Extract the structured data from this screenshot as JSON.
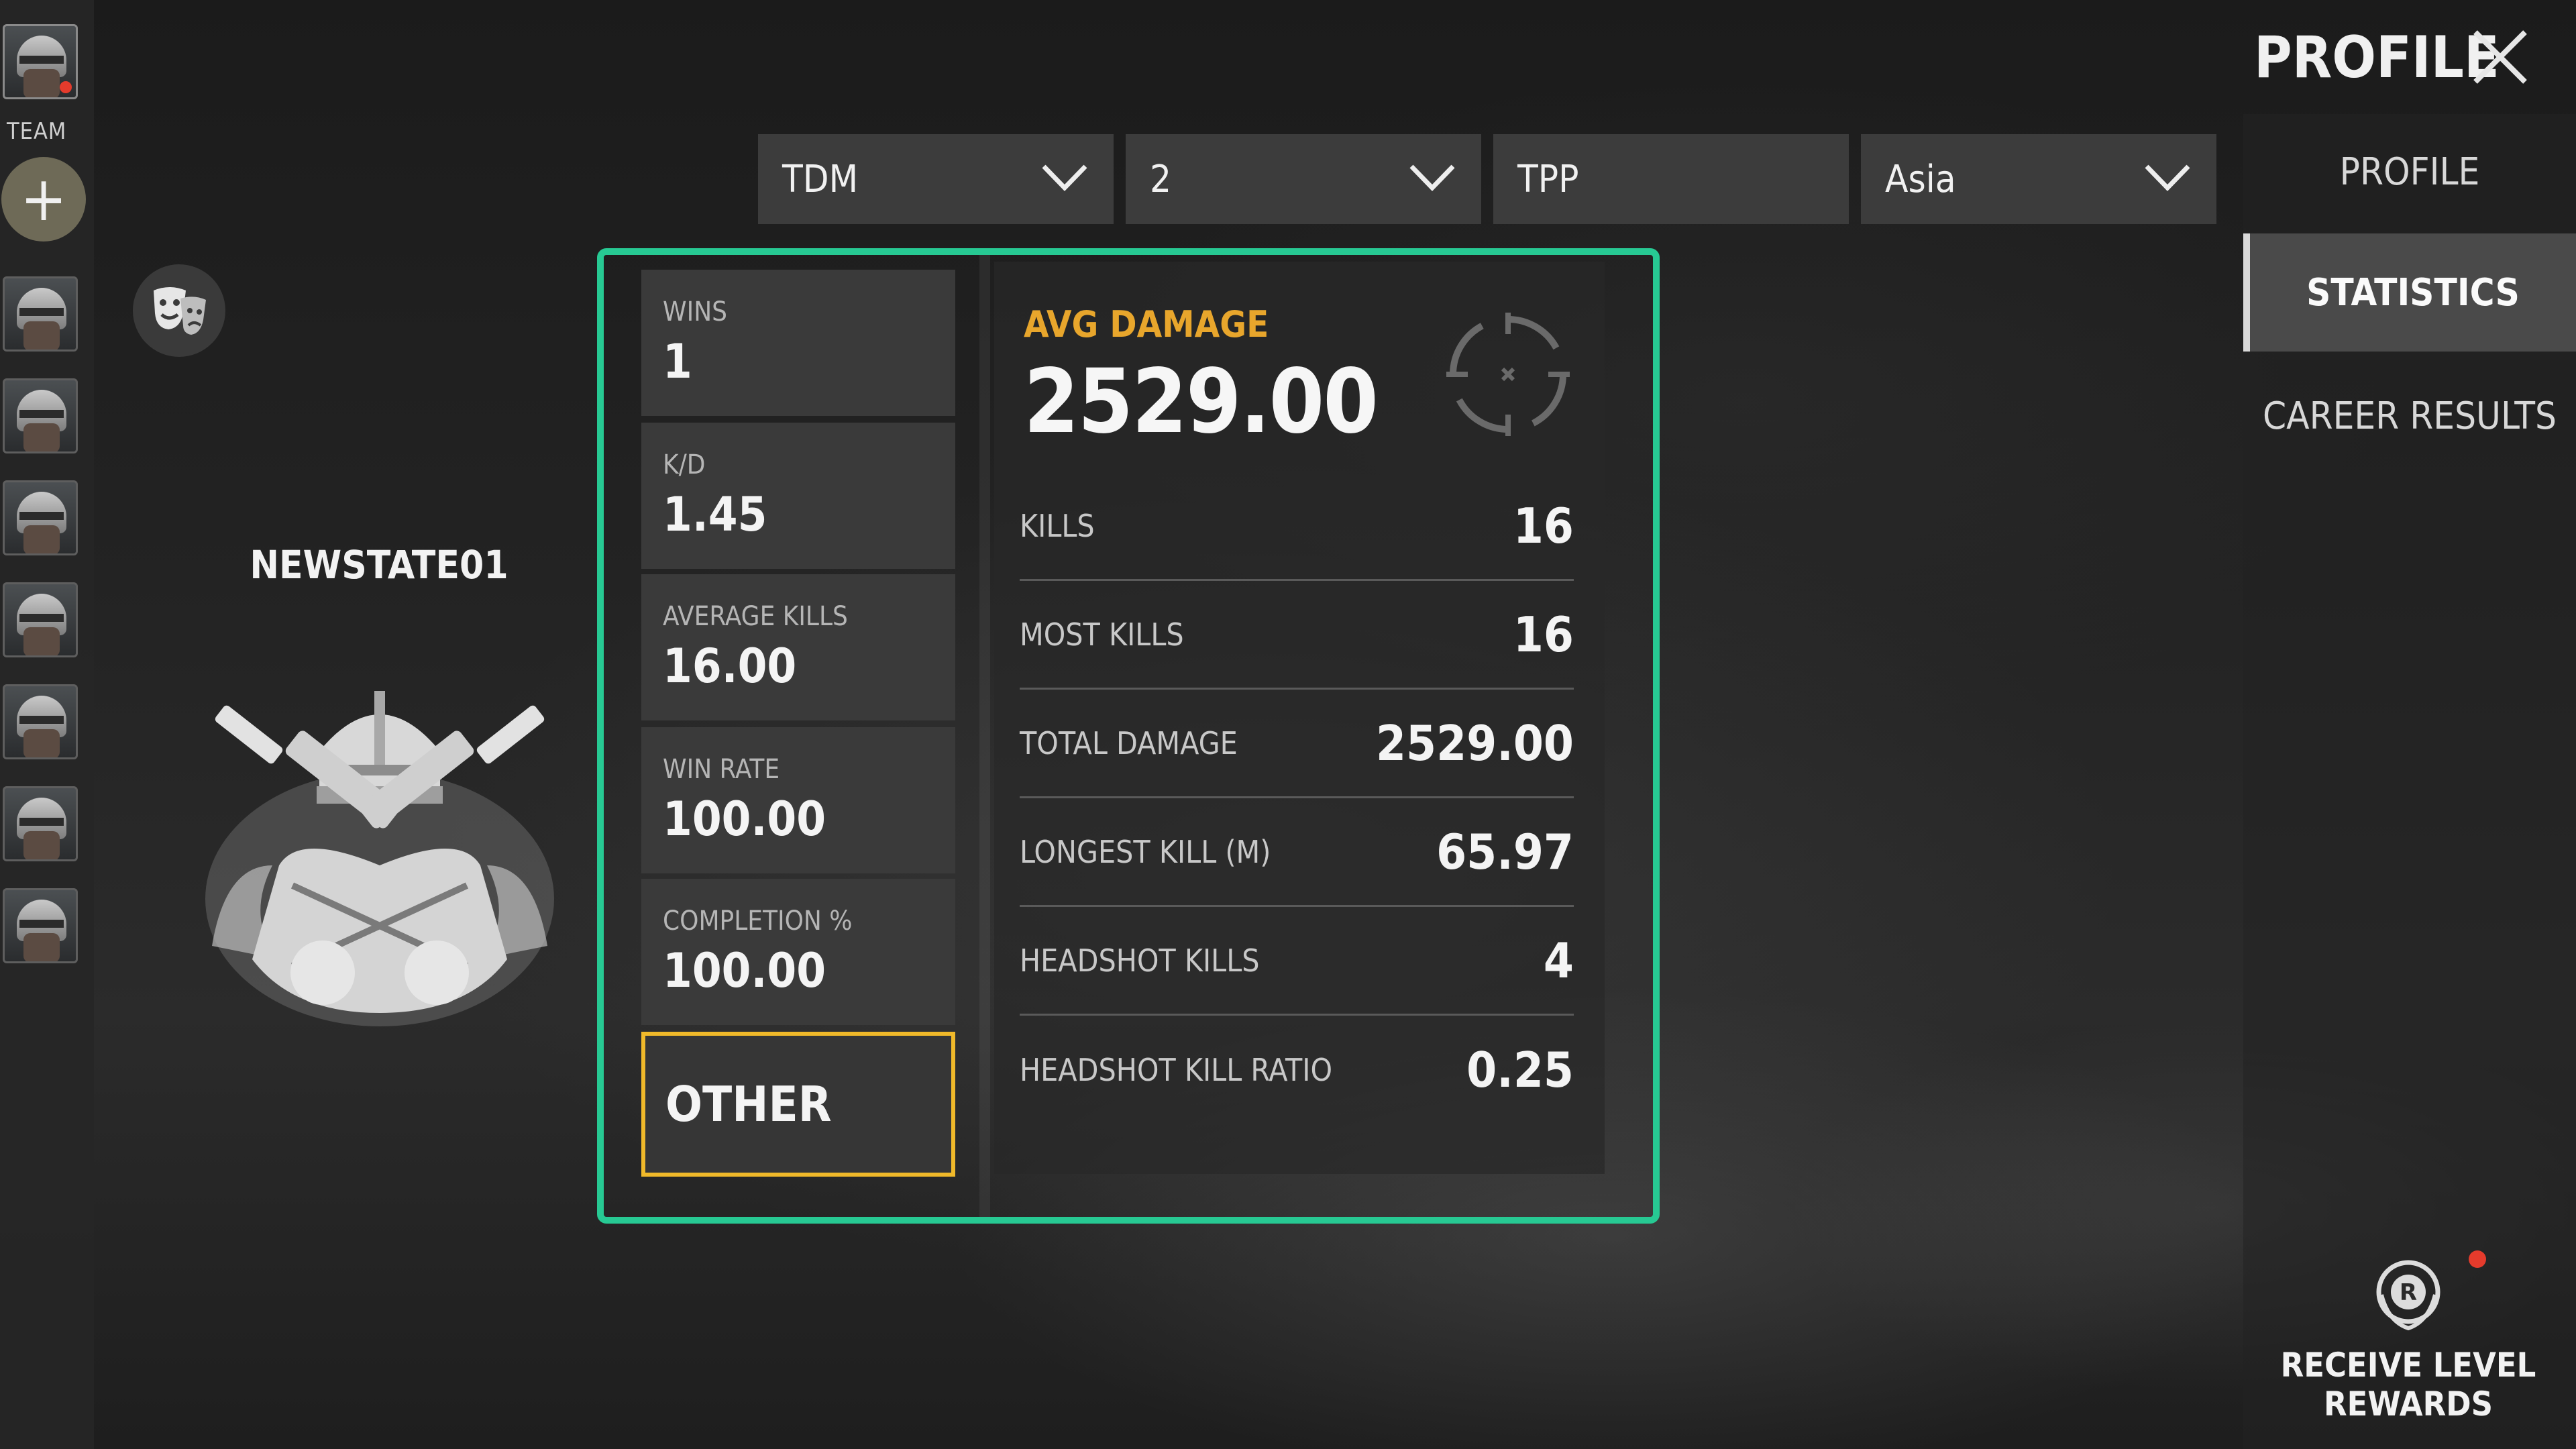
{
  "team": {
    "label": "TEAM",
    "add_symbol": "+",
    "slot_count": 7
  },
  "player": {
    "name": "NEWSTATE01"
  },
  "filters": {
    "mode": "TDM",
    "team_size": "2",
    "perspective": "TPP",
    "region": "Asia"
  },
  "summary_cards": [
    {
      "label": "WINS",
      "value": "1"
    },
    {
      "label": "K/D",
      "value": "1.45"
    },
    {
      "label": "AVERAGE KILLS",
      "value": "16.00"
    },
    {
      "label": "WIN RATE",
      "value": "100.00"
    },
    {
      "label": "COMPLETION %",
      "value": "100.00"
    }
  ],
  "other_button": "OTHER",
  "detail": {
    "avg_damage_label": "AVG DAMAGE",
    "avg_damage_value": "2529.00",
    "rows": [
      {
        "label": "KILLS",
        "value": "16"
      },
      {
        "label": "MOST KILLS",
        "value": "16"
      },
      {
        "label": "TOTAL DAMAGE",
        "value": "2529.00"
      },
      {
        "label": "LONGEST KILL (M)",
        "value": "65.97"
      },
      {
        "label": "HEADSHOT KILLS",
        "value": "4"
      },
      {
        "label": "HEADSHOT KILL RATIO",
        "value": "0.25"
      }
    ]
  },
  "header": {
    "title": "PROFILE"
  },
  "nav": {
    "items": [
      "PROFILE",
      "STATISTICS",
      "CAREER RESULTS"
    ],
    "active": "STATISTICS"
  },
  "rewards": {
    "label": "RECEIVE LEVEL REWARDS",
    "badge_letter": "R"
  },
  "colors": {
    "highlight_border": "#27c993",
    "selected_card_border": "#f0b92a",
    "avg_damage_label": "#e8a62c",
    "notification_dot": "#e53b2c"
  }
}
